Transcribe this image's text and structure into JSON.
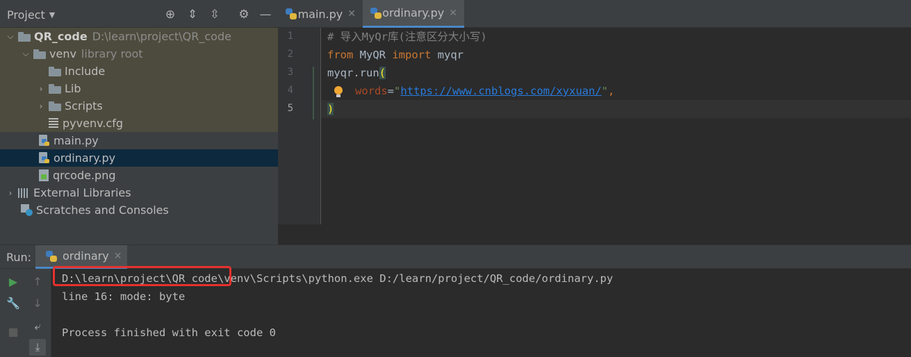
{
  "project_panel": {
    "title": "Project",
    "tree": [
      {
        "label": "QR_code",
        "hint": "D:\\learn\\project\\QR_code"
      },
      {
        "label": "venv",
        "hint": "library root"
      },
      {
        "label": "Include"
      },
      {
        "label": "Lib"
      },
      {
        "label": "Scripts"
      },
      {
        "label": "pyvenv.cfg"
      },
      {
        "label": "main.py"
      },
      {
        "label": "ordinary.py"
      },
      {
        "label": "qrcode.png"
      },
      {
        "label": "External Libraries"
      },
      {
        "label": "Scratches and Consoles"
      }
    ],
    "selected": "ordinary.py"
  },
  "editor": {
    "tabs": [
      {
        "label": "main.py",
        "active": false
      },
      {
        "label": "ordinary.py",
        "active": true
      }
    ],
    "line_numbers": [
      "1",
      "2",
      "3",
      "4",
      "5"
    ],
    "current_line": "5",
    "code": {
      "l1": "# 导入MyQr库(注意区分大小写)",
      "l2_kw1": "from",
      "l2_mod": " MyQR ",
      "l2_kw2": "import",
      "l2_name": " myqr",
      "l3_call": "myqr.run",
      "l3_paren": "(",
      "l4_param": "words",
      "l4_eq": "=",
      "l4_q1": "\"",
      "l4_url": "https://www.cnblogs.com/xyxuan/",
      "l4_q2": "\"",
      "l4_comma": ",",
      "l5_paren": ")"
    }
  },
  "run_panel": {
    "label": "Run:",
    "tab_label": "ordinary",
    "console": [
      "D:\\learn\\project\\QR_code\\venv\\Scripts\\python.exe D:/learn/project/QR_code/ordinary.py",
      "line 16: mode: byte",
      "",
      "Process finished with exit code 0"
    ]
  },
  "colors": {
    "selection": "#0d293e",
    "accent": "#4a88c7",
    "annotation_box": "#e5312e"
  }
}
